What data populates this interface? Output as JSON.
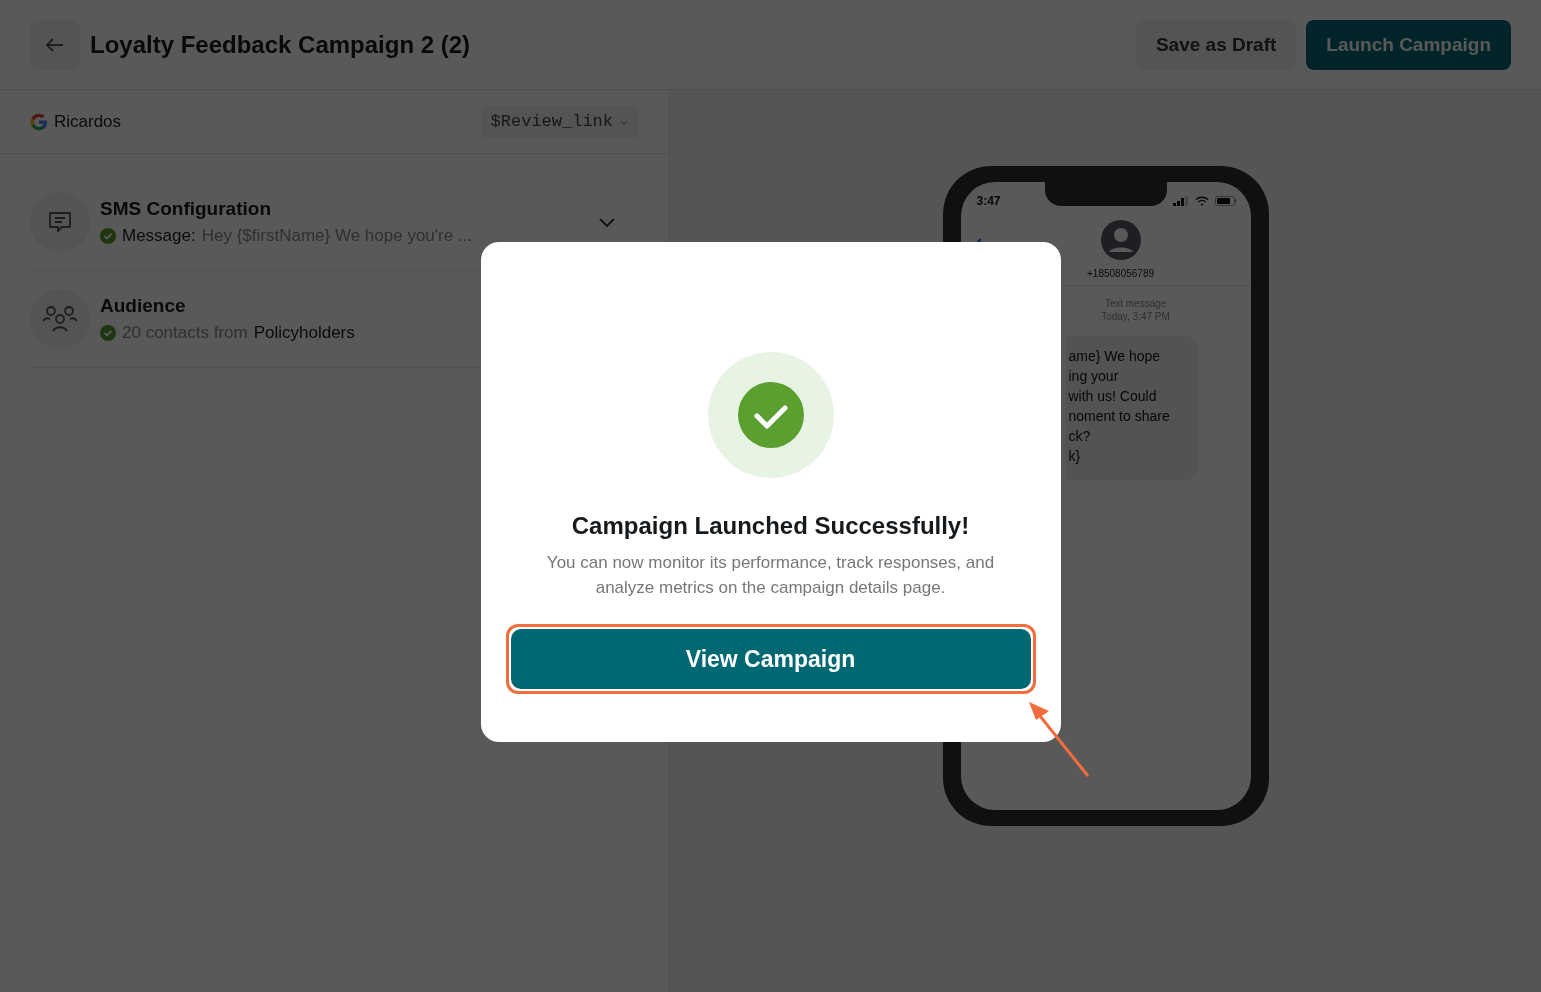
{
  "header": {
    "title": "Loyalty Feedback Campaign 2 (2)",
    "buttons": [
      {
        "label": "Save as Draft",
        "kind": "secondary"
      },
      {
        "label": "Launch Campaign",
        "kind": "primary"
      }
    ]
  },
  "source": {
    "name": "Ricardos",
    "variable": "$Review_link"
  },
  "sections": [
    {
      "kind": "sms",
      "title": "SMS Configuration",
      "done": true,
      "expanded": false,
      "parts": [
        {
          "text": "Message:",
          "emphasis": true
        },
        {
          "text": "Hey {$firstName} We hope you're ...",
          "emphasis": false
        }
      ]
    },
    {
      "kind": "audience",
      "title": "Audience",
      "done": true,
      "parts": [
        {
          "text": "20 contacts from",
          "emphasis": false
        },
        {
          "text": "Policyholders",
          "emphasis": true
        }
      ]
    }
  ],
  "phone": {
    "time": "3:47",
    "contact": "+18508056789",
    "meta": [
      "Text message",
      "Today, 3:47 PM"
    ],
    "bubble_lines": [
      "ame} We hope",
      "ing your",
      "with us! Could",
      "noment to share",
      "ck?",
      "k}"
    ]
  },
  "modal": {
    "title": "Campaign Launched Successfully!",
    "body": "You can now monitor its performance, track responses, and analyze metrics on the campaign details page.",
    "button": "View Campaign"
  }
}
